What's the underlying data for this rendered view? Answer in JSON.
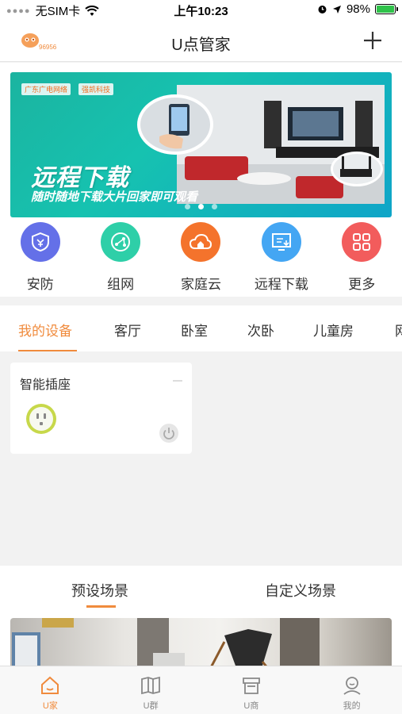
{
  "status": {
    "carrier": "无SIM卡",
    "time": "上午10:23",
    "battery": "98%",
    "battery_level": 0.98
  },
  "header": {
    "title": "U点管家",
    "logo_text": "96956"
  },
  "banner": {
    "brand_a": "广东广电网络",
    "brand_b": "强凯科技",
    "headline": "远程下载",
    "subline": "随时随地下载大片回家即可观看",
    "slides": 3,
    "active_slide": 2
  },
  "shortcuts": [
    {
      "label": "安防",
      "color": "#6470e8"
    },
    {
      "label": "组网",
      "color": "#2ecfa8"
    },
    {
      "label": "家庭云",
      "color": "#f4732c"
    },
    {
      "label": "远程下载",
      "color": "#44a6f3"
    },
    {
      "label": "更多",
      "color": "#f25c5c"
    }
  ],
  "rooms": [
    "我的设备",
    "客厅",
    "卧室",
    "次卧",
    "儿童房",
    "网"
  ],
  "device": {
    "name": "智能插座"
  },
  "scenes": {
    "preset": "预设场景",
    "custom": "自定义场景"
  },
  "tabbar": [
    {
      "label": "U家",
      "icon": "home-icon"
    },
    {
      "label": "U群",
      "icon": "book-icon"
    },
    {
      "label": "U商",
      "icon": "shop-icon"
    },
    {
      "label": "我的",
      "icon": "profile-icon"
    }
  ],
  "colors": {
    "accent": "#f08b3d",
    "background": "#f2f2f2"
  }
}
